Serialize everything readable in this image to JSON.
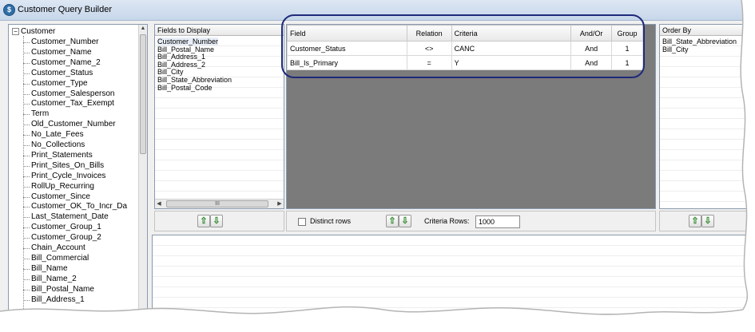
{
  "window": {
    "title": "Customer Query Builder",
    "icon": "app-icon"
  },
  "tree": {
    "root": "Customer",
    "items": [
      "Customer_Number",
      "Customer_Name",
      "Customer_Name_2",
      "Customer_Status",
      "Customer_Type",
      "Customer_Salesperson",
      "Customer_Tax_Exempt",
      "Term",
      "Old_Customer_Number",
      "No_Late_Fees",
      "No_Collections",
      "Print_Statements",
      "Print_Sites_On_Bills",
      "Print_Cycle_Invoices",
      "RollUp_Recurring",
      "Customer_Since",
      "Customer_OK_To_Incr_Da",
      "Last_Statement_Date",
      "Customer_Group_1",
      "Customer_Group_2",
      "Chain_Account",
      "Bill_Commercial",
      "Bill_Name",
      "Bill_Name_2",
      "Bill_Postal_Name",
      "Bill_Address_1"
    ]
  },
  "fields_to_display": {
    "header": "Fields to Display",
    "items": [
      "Customer_Number",
      "Bill_Postal_Name",
      "Bill_Address_1",
      "Bill_Address_2",
      "Bill_City",
      "Bill_State_Abbreviation",
      "Bill_Postal_Code"
    ],
    "hscroll_grip": "III"
  },
  "criteria": {
    "headers": [
      "Field",
      "Relation",
      "Criteria",
      "And/Or",
      "Group"
    ],
    "rows": [
      [
        "Customer_Status",
        "<>",
        "CANC",
        "And",
        "1"
      ],
      [
        "Bill_Is_Primary",
        "=",
        "Y",
        "And",
        "1"
      ]
    ],
    "distinct_label": "Distinct rows",
    "rows_label": "Criteria Rows:",
    "rows_value": "1000"
  },
  "order_by": {
    "header": "Order By",
    "items": [
      "Bill_State_Abbreviation",
      "Bill_City"
    ]
  },
  "glyphs": {
    "up": "⇧",
    "down": "⇩",
    "collapse": "−"
  }
}
